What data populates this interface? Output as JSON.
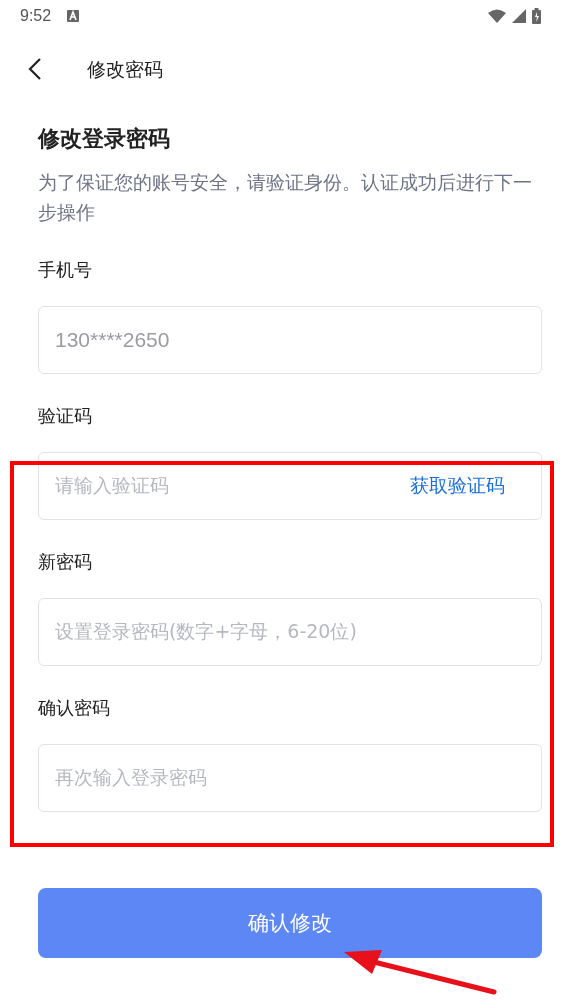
{
  "status_bar": {
    "time": "9:52"
  },
  "header": {
    "title": "修改密码"
  },
  "section": {
    "title": "修改登录密码",
    "description": "为了保证您的账号安全，请验证身份。认证成功后进行下一步操作"
  },
  "fields": [
    {
      "label": "手机号",
      "value": "130****2650",
      "disabled": true
    },
    {
      "label": "验证码",
      "placeholder": "请输入验证码",
      "action": "获取验证码",
      "disabled": false
    },
    {
      "label": "新密码",
      "placeholder": "设置登录密码(数字+字母，6-20位)",
      "disabled": false
    },
    {
      "label": "确认密码",
      "placeholder": "再次输入登录密码",
      "disabled": false
    }
  ],
  "submit": {
    "label": "确认修改"
  }
}
